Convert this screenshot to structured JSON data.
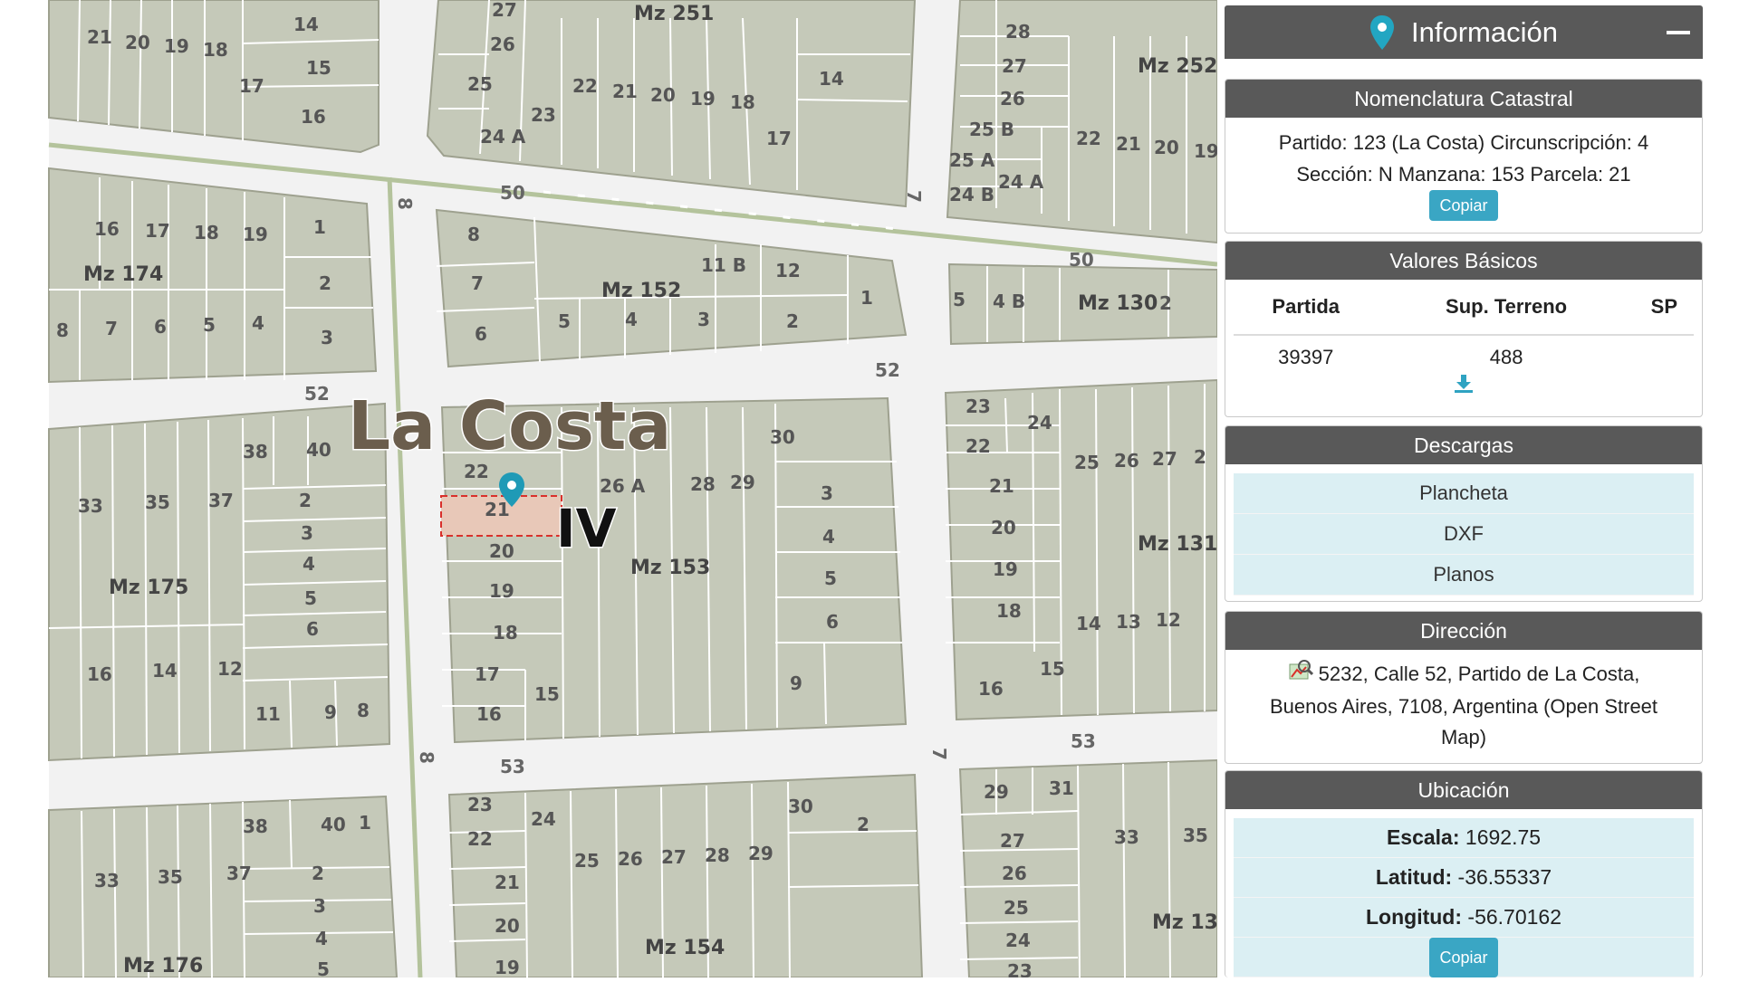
{
  "panel": {
    "title": "Información",
    "icons": {
      "pin": "map-pin-icon",
      "minimize": "minus-icon",
      "download": "download-icon",
      "map": "map-icon"
    },
    "nomenclatura": {
      "header": "Nomenclatura Catastral",
      "line1": "Partido: 123 (La Costa) Circunscripción: 4",
      "line2": "Sección: N Manzana: 153 Parcela: 21",
      "copy_label": "Copiar"
    },
    "valores": {
      "header": "Valores Básicos",
      "columns": [
        "Partida",
        "Sup. Terreno",
        "SP"
      ],
      "row": [
        "39397",
        "488",
        ""
      ]
    },
    "descargas": {
      "header": "Descargas",
      "items": [
        "Plancheta",
        "DXF",
        "Planos"
      ]
    },
    "direccion": {
      "header": "Dirección",
      "line1": "5232, Calle 52, Partido de La Costa,",
      "line2": "Buenos Aires, 7108, Argentina (Open Street",
      "line3": "Map)"
    },
    "ubicacion": {
      "header": "Ubicación",
      "escala_label": "Escala:",
      "escala": "1692.75",
      "latitud_label": "Latitud:",
      "latitud": "-36.55337",
      "longitud_label": "Longitud:",
      "longitud": "-56.70162",
      "copy_label": "Copiar"
    }
  },
  "map": {
    "place_label": "La Costa",
    "section_label": "IV",
    "selected_parcel": "21",
    "blocks": {
      "mz251": "Mz 251",
      "mz252": "Mz 252",
      "mz174": "Mz 174",
      "mz152": "Mz 152",
      "mz130": "Mz 130",
      "mz175": "Mz 175",
      "mz153": "Mz 153",
      "mz131": "Mz 131",
      "mz176": "Mz 176",
      "mz154": "Mz 154",
      "mz13x": "Mz 13"
    },
    "streets": {
      "s50a": "50",
      "s50b": "50",
      "s52a": "52",
      "s52b": "52",
      "s53a": "53",
      "s53b": "53",
      "s8a": "8",
      "s8b": "8",
      "s7a": "7",
      "s7b": "7"
    },
    "colors": {
      "block": "#c5c9b9",
      "parcel_line": "#ffffff",
      "road": "#f2f2f2",
      "rail": "#b4c39c",
      "selected": "#e8c8b8",
      "selected_border": "#d9302b",
      "pin": "#1f9ab6"
    }
  }
}
